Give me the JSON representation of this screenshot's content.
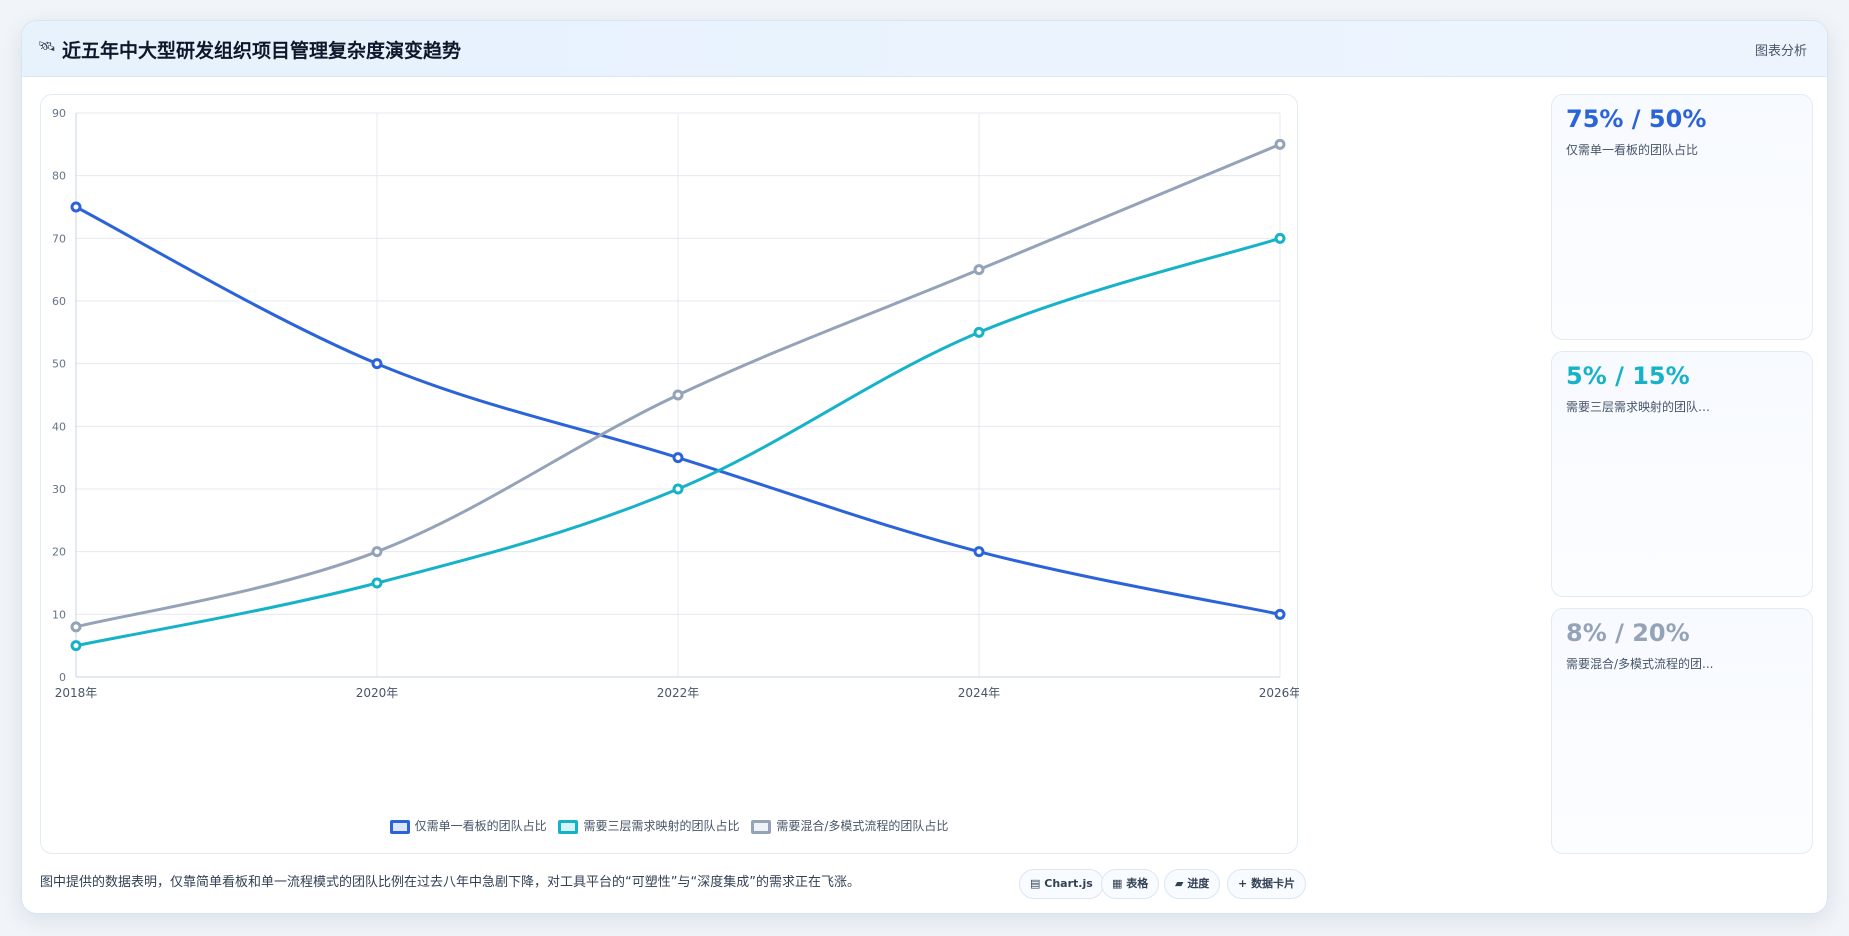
{
  "header": {
    "icon": "🛰",
    "title": "近五年中大型研发组织项目管理复杂度演变趋势",
    "action_label": "图表分析"
  },
  "colors": {
    "blue": "#2b63d9",
    "cyan": "#16b3c8",
    "gray": "#94a3b8"
  },
  "chart_data": {
    "type": "line",
    "x": [
      "2018年",
      "2020年",
      "2022年",
      "2024年",
      "2026年"
    ],
    "ylim": [
      0,
      90
    ],
    "yticks": [
      0,
      10,
      20,
      30,
      40,
      50,
      60,
      70,
      80,
      90
    ],
    "grid": true,
    "legend_position": "bottom",
    "series": [
      {
        "name": "仅需单一看板的团队占比",
        "values": [
          75,
          50,
          35,
          20,
          10
        ],
        "color": "#2b63d9"
      },
      {
        "name": "需要三层需求映射的团队占比",
        "values": [
          5,
          15,
          30,
          55,
          70
        ],
        "color": "#16b3c8"
      },
      {
        "name": "需要混合/多模式流程的团队占比",
        "values": [
          8,
          20,
          45,
          65,
          85
        ],
        "color": "#94a3b8"
      }
    ]
  },
  "stats": [
    {
      "value": "75% / 50%",
      "label": "仅需单一看板的团队占比",
      "color": "#2b63d9"
    },
    {
      "value": "5% / 15%",
      "label": "需要三层需求映射的团队占...",
      "color": "#16b3c8"
    },
    {
      "value": "8% / 20%",
      "label": "需要混合/多模式流程的团...",
      "color": "#94a3b8"
    }
  ],
  "footer": {
    "text": "图中提供的数据表明，仅靠简单看板和单一流程模式的团队比例在过去八年中急剧下降，对工具平台的“可塑性”与“深度集成”的需求正在飞涨。",
    "buttons": [
      {
        "icon": "▤",
        "label": "Chart.js"
      },
      {
        "icon": "▦",
        "label": "表格"
      },
      {
        "icon": "▰",
        "label": "进度"
      },
      {
        "icon": "+",
        "label": "数据卡片"
      }
    ]
  }
}
